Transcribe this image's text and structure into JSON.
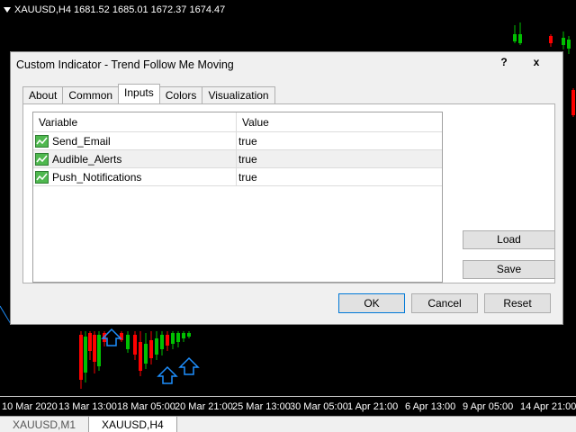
{
  "chart": {
    "symbol_header": "XAUUSD,H4  1681.52 1685.01 1672.37 1674.47",
    "time_labels": [
      "10 Mar 2020",
      "13 Mar 13:00",
      "18 Mar 05:00",
      "20 Mar 21:00",
      "25 Mar 13:00",
      "30 Mar 05:00",
      "1 Apr 21:00",
      "6 Apr 13:00",
      "9 Apr 05:00",
      "14 Apr 21:00"
    ],
    "bull_color": "#00c000",
    "bear_color": "#ff0000",
    "arrow_color": "#1e90ff"
  },
  "bottom_tabs": [
    "XAUUSD,M1",
    "XAUUSD,H4"
  ],
  "dialog": {
    "title": "Custom Indicator - Trend Follow Me Moving",
    "help_label": "?",
    "close_label": "x",
    "tabs": [
      "About",
      "Common",
      "Inputs",
      "Colors",
      "Visualization"
    ],
    "active_tab": "Inputs",
    "grid": {
      "headers": [
        "Variable",
        "Value"
      ],
      "rows": [
        {
          "variable": "Send_Email",
          "value": "true"
        },
        {
          "variable": "Audible_Alerts",
          "value": "true"
        },
        {
          "variable": "Push_Notifications",
          "value": "true"
        }
      ]
    },
    "load_label": "Load",
    "save_label": "Save",
    "ok_label": "OK",
    "cancel_label": "Cancel",
    "reset_label": "Reset"
  }
}
